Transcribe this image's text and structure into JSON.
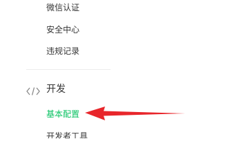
{
  "sidebar": {
    "items": [
      {
        "label": "微信认证"
      },
      {
        "label": "安全中心"
      },
      {
        "label": "违规记录"
      }
    ],
    "section": {
      "icon": "code-icon",
      "title": "开发",
      "items": [
        {
          "label": "基本配置",
          "active": true
        },
        {
          "label": "开发者工具"
        }
      ]
    }
  },
  "annotation": {
    "arrow_color": "#e8262b"
  },
  "colors": {
    "active_text": "#07c160",
    "normal_text": "#353535",
    "icon": "#8a8a8a",
    "divider": "#ececec"
  }
}
